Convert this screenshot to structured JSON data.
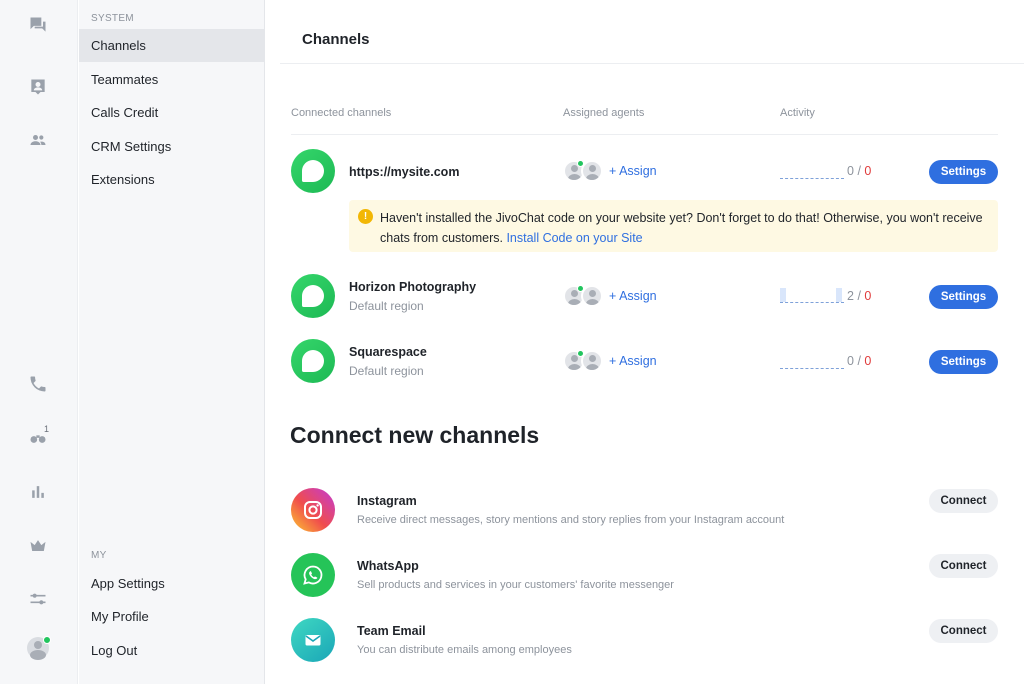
{
  "rail": {
    "icons": [
      "chats-icon",
      "contacts-card-icon",
      "team-icon",
      "phone-icon",
      "visitors-icon",
      "reports-icon",
      "crown-icon",
      "sliders-icon",
      "avatar"
    ],
    "visitors_badge": "1"
  },
  "nav": {
    "system_section": "SYSTEM",
    "system_items": [
      {
        "label": "Channels",
        "active": true
      },
      {
        "label": "Teammates"
      },
      {
        "label": "Calls Credit"
      },
      {
        "label": "CRM Settings"
      },
      {
        "label": "Extensions"
      }
    ],
    "my_section": "MY",
    "my_items": [
      {
        "label": "App Settings"
      },
      {
        "label": "My Profile"
      },
      {
        "label": "Log Out"
      }
    ]
  },
  "header": {
    "title": "Channels"
  },
  "table": {
    "col_connected": "Connected channels",
    "col_agents": "Assigned agents",
    "col_activity": "Activity"
  },
  "channels": [
    {
      "name": "https://mysite.com",
      "sub": "",
      "assign": "+ Assign",
      "count_a": "0",
      "sep": "/",
      "count_b": "0",
      "settings": "Settings"
    },
    {
      "name": "Horizon Photography",
      "sub": "Default region",
      "assign": "+ Assign",
      "count_a": "2",
      "sep": "/",
      "count_b": "0",
      "settings": "Settings"
    },
    {
      "name": "Squarespace",
      "sub": "Default region",
      "assign": "+ Assign",
      "count_a": "0",
      "sep": "/",
      "count_b": "0",
      "settings": "Settings"
    }
  ],
  "warning": {
    "text": "Haven't installed the JivoChat code on your website yet? Don't forget to do that! Otherwise, you won't receive chats from customers.",
    "link": "Install Code on your Site"
  },
  "connect_new": {
    "title": "Connect new channels",
    "items": [
      {
        "name": "Instagram",
        "desc": "Receive direct messages, story mentions and story replies from your Instagram account",
        "button": "Connect",
        "icon": "instagram-icon"
      },
      {
        "name": "WhatsApp",
        "desc": "Sell products and services in your customers' favorite messenger",
        "button": "Connect",
        "icon": "whatsapp-icon"
      },
      {
        "name": "Team Email",
        "desc": "You can distribute emails among employees",
        "button": "Connect",
        "icon": "mail-icon"
      }
    ]
  },
  "colors": {
    "accent": "#2f6fe0",
    "jivo_green": "#1db954",
    "warning_bg": "#fef9e3",
    "danger": "#e03b3b"
  }
}
